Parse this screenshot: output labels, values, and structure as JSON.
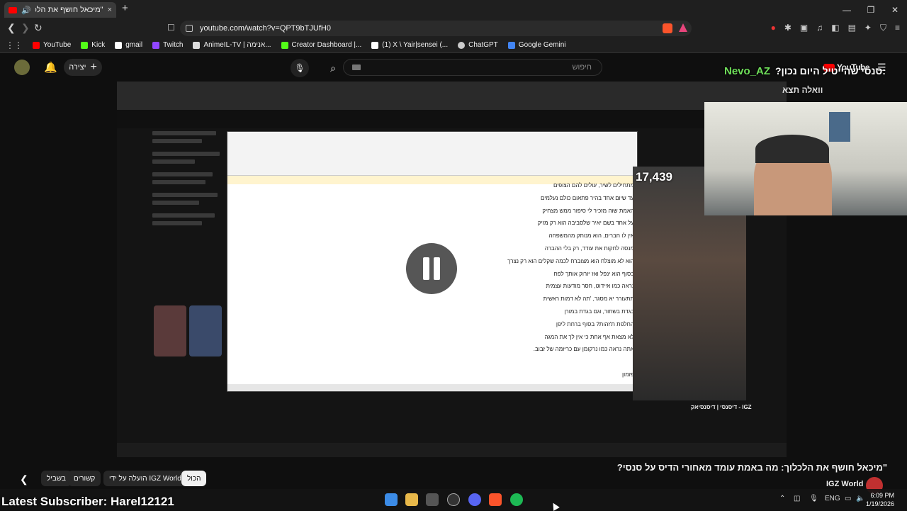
{
  "browser": {
    "tab_title": "\"מיכאל חושף את הלכלוך: מה",
    "tab_close": "×",
    "new_tab": "+",
    "window_controls": [
      "—",
      "❐",
      "✕"
    ],
    "url": "youtube.com/watch?v=QPT9bTJUfH0"
  },
  "bookmarks": [
    {
      "label": "YouTube",
      "color": "#ff0000"
    },
    {
      "label": "Kick",
      "color": "#53fc18"
    },
    {
      "label": "gmail",
      "color": "#ffffff"
    },
    {
      "label": "Twitch",
      "color": "#9146ff"
    },
    {
      "label": "AnimeIL-TV | אנימה...",
      "color": "#ffffff"
    },
    {
      "label": "Creator Dashboard |...",
      "color": "#53fc18"
    },
    {
      "label": "(1) X \\ Yair|sensei (...",
      "color": "#ffffff"
    },
    {
      "label": "ChatGPT",
      "color": "#cccccc"
    },
    {
      "label": "Google Gemini",
      "color": "#4285f4"
    }
  ],
  "youtube": {
    "create_label": "יצירה",
    "search_placeholder": "חיפוש",
    "logo_text": "YouTube",
    "video_title": "\"מיכאל חושף את הלכלוך: מה באמת עומד מאחורי הדיס על סנסי?",
    "channel": "IGZ World",
    "chips": [
      "הכול",
      "הועלה על ידי IGZ World",
      "קשורים",
      "בשביל"
    ]
  },
  "stream_overlay": {
    "chatter": "Nevo_AZ",
    "chat_message": ":סנסי שהייטיל היום נכון?",
    "chat_message_2": "וואלה תצא",
    "viewer_count": "17,439",
    "latest_subscriber": "Latest Subscriber: Harel12121"
  },
  "inner_video": {
    "doc_lines": [
      "מתחילים לשיר, עולים להם הצופים",
      "עד שיום אחד בהיר פתאום כולם נעלמים",
      "האמת שזה מזכיר לי סיפור ממש מצחיק",
      "על אחד בשם יאיר שלסביבה הוא רק מזיק",
      "אין לו חברים, הוא מנותק מהמשפחה",
      "מנסה לחקות את עודד, רק בלי ההברה",
      "הוא לא מוצלח הוא מצוברח לכמה שקלים הוא רק נצרך",
      "בסוף הוא ינפל ואז יזרוק אותך לפח",
      "נראה כמו איידוט, חסר מודעות עצמית",
      "תתעורר יא מסגר, 'תה לא דמות ראשית",
      "בגדת בשחור, וגם בגדת במורן",
      "החלפת ת'זהות? בסוף ברחת ליפן",
      "לא מצאת אף אחת כי אין לך את המגה",
      "אתה נראה כמו נרקומן עם כריזמה של זבוב.",
      "פזמון"
    ],
    "channel_title": "דיסנסי | דיסנסיאק - IGZ"
  },
  "taskbar": {
    "language": "ENG",
    "time": "6:09 PM",
    "date": "1/19/2026"
  }
}
